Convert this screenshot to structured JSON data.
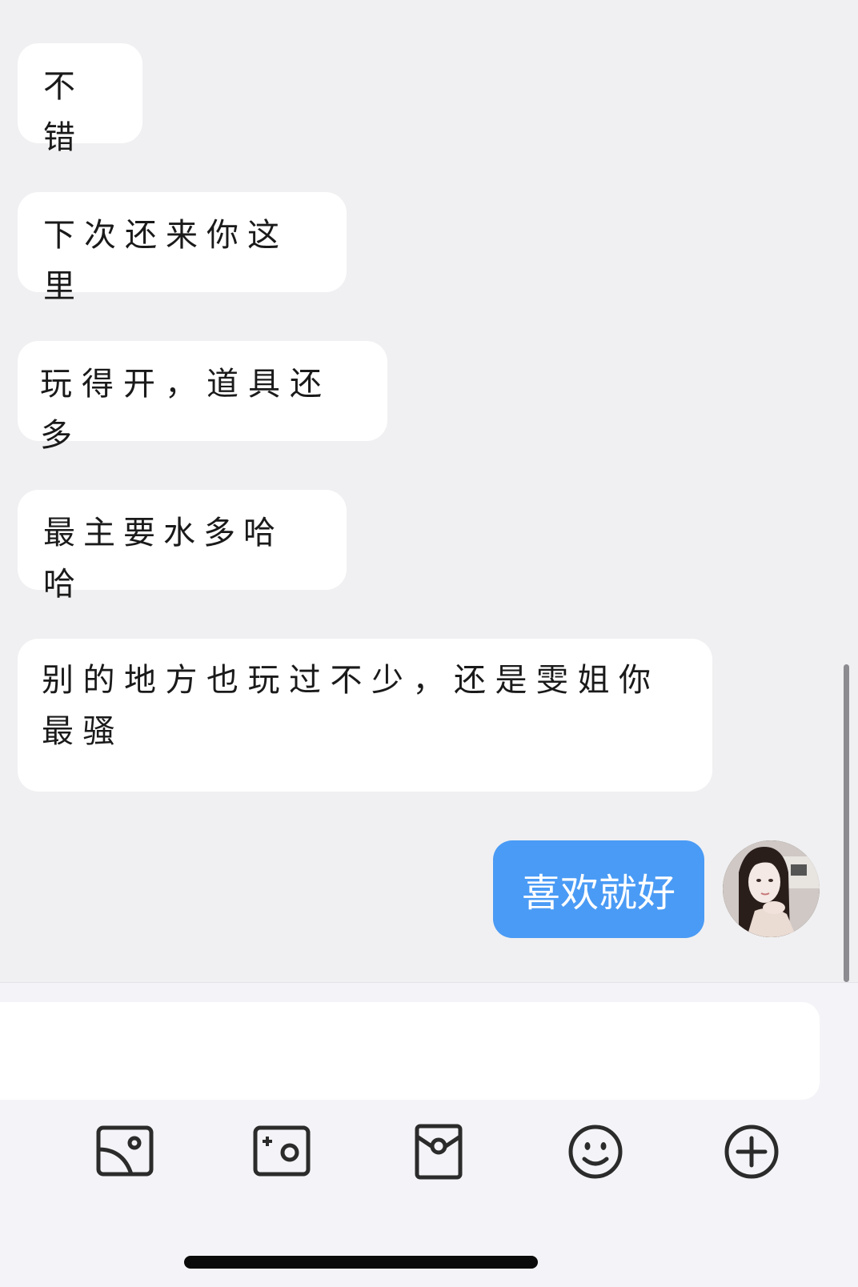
{
  "messages": [
    {
      "from": "other",
      "text": "不错"
    },
    {
      "from": "other",
      "text": "下次还来你这里"
    },
    {
      "from": "other",
      "text": "玩得开，道具还多"
    },
    {
      "from": "other",
      "text": "最主要水多哈哈"
    },
    {
      "from": "other",
      "text": "别的地方也玩过不少，还是雯姐你最骚"
    },
    {
      "from": "self",
      "text": "喜欢就好"
    }
  ],
  "toolbar": {
    "icons": [
      "photo-album-icon",
      "camera-icon",
      "red-packet-icon",
      "emoji-icon",
      "plus-circle-icon"
    ]
  },
  "colors": {
    "chat_background": "#f0f0f2",
    "incoming_bubble": "#ffffff",
    "outgoing_bubble": "#4a9bf5",
    "icon_stroke": "#2b2b2b"
  }
}
